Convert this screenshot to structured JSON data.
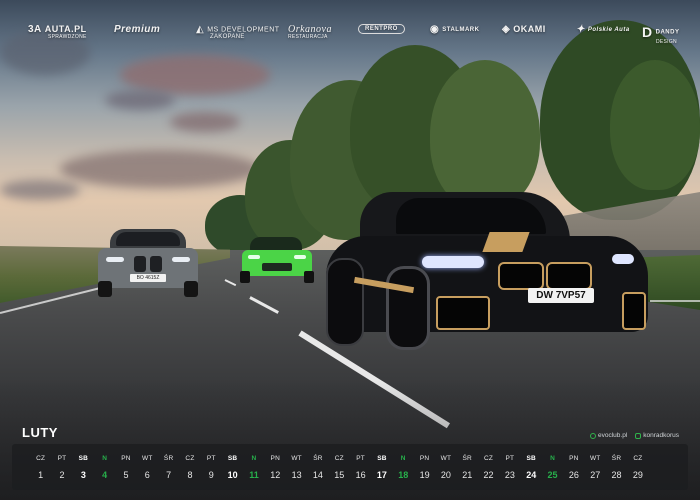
{
  "sponsors": [
    {
      "name": "AUTA.PL",
      "mark": "3A",
      "sub": "SPRAWDZONE"
    },
    {
      "name": "Premium",
      "mark": "",
      "sub": ""
    },
    {
      "name": "MS DEVELOPMENT",
      "mark": "◭",
      "sub": "ZAKOPANE"
    },
    {
      "name": "Orkanova",
      "mark": "",
      "sub": "RESTAURACJA"
    },
    {
      "name": "RENTPRO",
      "mark": "",
      "sub": ""
    },
    {
      "name": "STALMARK",
      "mark": "◉",
      "sub": ""
    },
    {
      "name": "OKAMI",
      "mark": "◈",
      "sub": ""
    },
    {
      "name": "Polskie Auta",
      "mark": "✦",
      "sub": ""
    },
    {
      "name": "DANDY",
      "mark": "D",
      "sub": "DESIGN"
    }
  ],
  "photo": {
    "plate_left": "BO 4615Z",
    "plate_right": "DW 7VP57"
  },
  "calendar": {
    "month": "LUTY",
    "socials": [
      {
        "icon": "globe-icon",
        "label": "evoclub.pl"
      },
      {
        "icon": "instagram-icon",
        "label": "konradkorus"
      }
    ],
    "days": [
      {
        "dow": "CZ",
        "day": "1",
        "type": "wd"
      },
      {
        "dow": "PT",
        "day": "2",
        "type": "wd"
      },
      {
        "dow": "SB",
        "day": "3",
        "type": "sat"
      },
      {
        "dow": "N",
        "day": "4",
        "type": "sun"
      },
      {
        "dow": "PN",
        "day": "5",
        "type": "wd"
      },
      {
        "dow": "WT",
        "day": "6",
        "type": "wd"
      },
      {
        "dow": "ŚR",
        "day": "7",
        "type": "wd"
      },
      {
        "dow": "CZ",
        "day": "8",
        "type": "wd"
      },
      {
        "dow": "PT",
        "day": "9",
        "type": "wd"
      },
      {
        "dow": "SB",
        "day": "10",
        "type": "sat"
      },
      {
        "dow": "N",
        "day": "11",
        "type": "sun"
      },
      {
        "dow": "PN",
        "day": "12",
        "type": "wd"
      },
      {
        "dow": "WT",
        "day": "13",
        "type": "wd"
      },
      {
        "dow": "ŚR",
        "day": "14",
        "type": "wd"
      },
      {
        "dow": "CZ",
        "day": "15",
        "type": "wd"
      },
      {
        "dow": "PT",
        "day": "16",
        "type": "wd"
      },
      {
        "dow": "SB",
        "day": "17",
        "type": "sat"
      },
      {
        "dow": "N",
        "day": "18",
        "type": "sun"
      },
      {
        "dow": "PN",
        "day": "19",
        "type": "wd"
      },
      {
        "dow": "WT",
        "day": "20",
        "type": "wd"
      },
      {
        "dow": "ŚR",
        "day": "21",
        "type": "wd"
      },
      {
        "dow": "CZ",
        "day": "22",
        "type": "wd"
      },
      {
        "dow": "PT",
        "day": "23",
        "type": "wd"
      },
      {
        "dow": "SB",
        "day": "24",
        "type": "sat"
      },
      {
        "dow": "N",
        "day": "25",
        "type": "sun"
      },
      {
        "dow": "PN",
        "day": "26",
        "type": "wd"
      },
      {
        "dow": "WT",
        "day": "27",
        "type": "wd"
      },
      {
        "dow": "ŚR",
        "day": "28",
        "type": "wd"
      },
      {
        "dow": "CZ",
        "day": "29",
        "type": "wd"
      }
    ]
  },
  "colors": {
    "sunday": "#27b04b",
    "panel": "#1c1d20",
    "text": "#e6e6e6"
  }
}
